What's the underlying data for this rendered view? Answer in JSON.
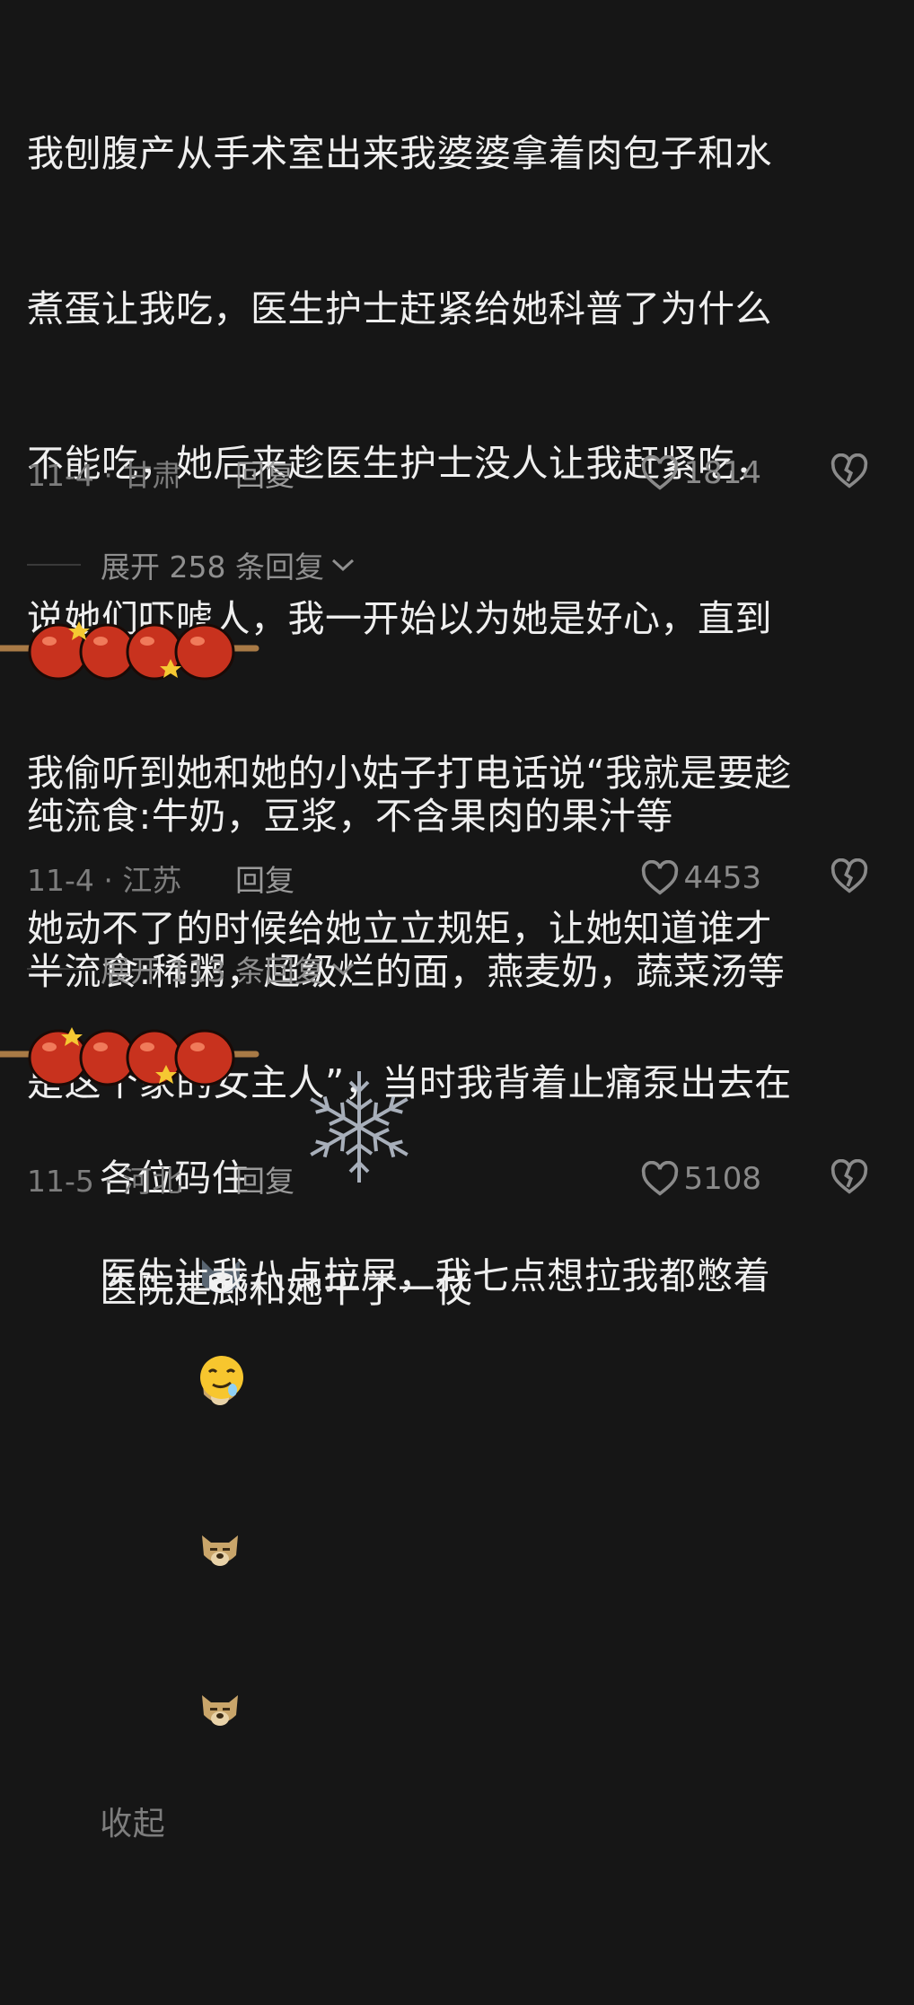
{
  "comments": [
    {
      "lines": [
        "我刨腹产从手术室出来我婆婆拿着肉包子和水",
        "煮蛋让我吃，医生护士赶紧给她科普了为什么",
        "不能吃，她后来趁医生护士没人让我赶紧吃，",
        "说她们吓唬人，我一开始以为她是好心，直到",
        "我偷听到她和她的小姑子打电话说“我就是要趁",
        "她动不了的时候给她立立规矩，让她知道谁才",
        "是这个家的女主人”，当时我背着止痛泵出去在",
        "医院走廊和她干了一仗"
      ],
      "emojis": [
        "dog-face-icon",
        "dog-face-icon",
        "dog-face-icon"
      ],
      "collapse_label": "收起",
      "date_location": "11-4 · 甘肃",
      "reply_label": "回复",
      "likes": "1814",
      "expand_label": "展开 258 条回复"
    },
    {
      "lines": [
        "纯流食:牛奶，豆浆，不含果肉的果汁等",
        "半流食:稀粥，超级烂的面，燕麦奶，蔬菜汤等",
        "各位码住"
      ],
      "emojis": [
        "husky-face-icon"
      ],
      "date_location": "11-4 · 江苏",
      "reply_label": "回复",
      "likes": "4453",
      "expand_label": "展开 113 条回复"
    },
    {
      "lines": [
        "医生让我八点拉屎，我七点想拉我都憋着"
      ],
      "emojis": [
        "drooling-face-icon"
      ],
      "date_location": "11-5 · 河北",
      "reply_label": "回复",
      "likes": "5108"
    }
  ],
  "colors": {
    "background": "#161616",
    "text": "#efefef",
    "muted": "#7d7d7d",
    "berry": "#c8321e"
  }
}
